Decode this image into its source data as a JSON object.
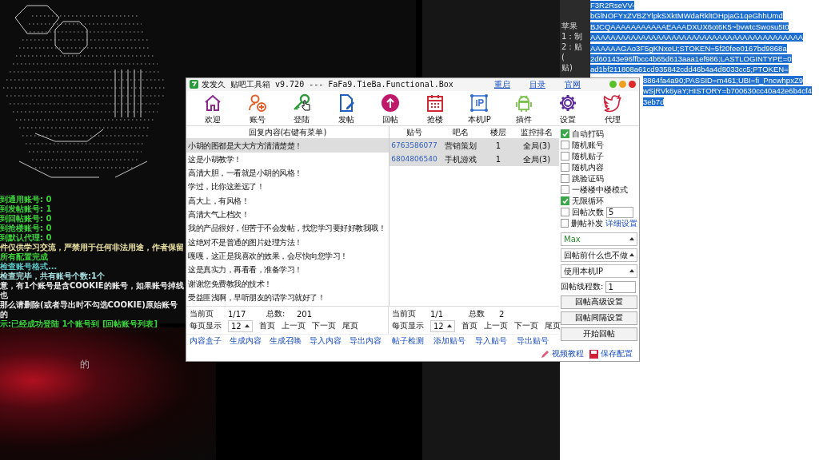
{
  "console": {
    "lines": [
      {
        "text": "到通用账号: 0",
        "color": "#3cd23c"
      },
      {
        "text": "到发帖账号: 1",
        "color": "#3cd23c"
      },
      {
        "text": "到回帖账号: 0",
        "color": "#3cd23c"
      },
      {
        "text": "到抢楼账号: 0",
        "color": "#3cd23c"
      },
      {
        "text": "到默认代理: 0",
        "color": "#3cd23c"
      },
      {
        "text": "件仅供学习交流，严禁用于任何非法用途，作者保留",
        "color": "#e8e0a0"
      },
      {
        "text": "所有配置完成",
        "color": "#3cd23c"
      },
      {
        "text": "检查账号格式...",
        "color": "#5ac8c8"
      },
      {
        "text": "检查完毕，共有账号个数:1个",
        "color": "#a8e0e0"
      },
      {
        "text": "意，有1个账号是含COOKIE的账号，如果账号掉线也",
        "color": "#e8e8e8"
      },
      {
        "text": "那么请删除(或者导出时不勾选COOKIE)原始账号的",
        "color": "#e8e8e8"
      },
      {
        "text": "示:已经成功登陆 1个账号到 [回帖账号列表]",
        "color": "#3cd23c"
      }
    ]
  },
  "background_text": "的",
  "editor": {
    "gutter_lines": [
      "苹果",
      "1：制",
      "2：贴",
      "(",
      "贴)"
    ],
    "selected_lines": [
      "F3R2RseVV-",
      "bGlNOFYxZVBZYlpkSXktMWdaRkltOHpjaG1qeGhhUmd",
      "BJCQAAAAAAAAAAAEAAADXUX6ot6K5~bvwtcSwosu5t0",
      "AAAAAAAAAAAAAAAAAAAAAAAAAAAAAAAAAAAAAAAAAA",
      "AAAAAAGAo3F5gKNxeU;STOKEN=5f20fee0167bd9868a",
      "2d60143e96ffbcc4b65d613aaa1ef986;LASTLOGINTYPE=0",
      "ad1bf211808a61cd935842cdd46b4a4d8033cc5;PTOKEN=",
      "8864fa4a90;PASSID=m461;UBI=fi_PncwhpxZ9",
      "wSjRVk6yaY;HISTORY=b700630cc40a42e6b4cf4",
      "3eb7d"
    ]
  },
  "app": {
    "title": "发发久  贴吧工具箱 v9.720 --- FaFa9.TieBa.Functional.Box",
    "header_links": [
      "重启",
      "目录",
      "官网"
    ],
    "toolbar": [
      {
        "label": "欢迎"
      },
      {
        "label": "账号"
      },
      {
        "label": "登陆"
      },
      {
        "label": "发帖"
      },
      {
        "label": "回帖"
      },
      {
        "label": "抢楼"
      },
      {
        "label": "本机IP"
      },
      {
        "label": "插件"
      },
      {
        "label": "设置"
      },
      {
        "label": "代理"
      }
    ],
    "reply_table": {
      "header": "回复内容(右键有菜单)",
      "rows": [
        {
          "text": "小胡的图都是大大方方清清楚楚！",
          "selected": true
        },
        {
          "text": "这是小胡教学！",
          "selected": false
        },
        {
          "text": "高清大胆，一看就是小胡的风格！",
          "selected": false
        },
        {
          "text": "学过，比你这差远了！",
          "selected": false
        },
        {
          "text": "高大上，有风格！",
          "selected": false
        },
        {
          "text": "高清大气上档次！",
          "selected": false
        },
        {
          "text": "我的产品很好，但苦于不会发帖，找您学习要好好教我哦！",
          "selected": false
        },
        {
          "text": "这绝对不是普通的图片处理方法！",
          "selected": false
        },
        {
          "text": "嘎嘎，这正是我喜欢的效果，会尽快向您学习！",
          "selected": false
        },
        {
          "text": "这是真实力，再看看，准备学习！",
          "selected": false
        },
        {
          "text": "谢谢您免费教我的技术！",
          "selected": false
        },
        {
          "text": "受益匪浅啊，早听朋友的话学习就好了！",
          "selected": false
        }
      ]
    },
    "post_table": {
      "columns": [
        "贴号",
        "吧名",
        "楼层",
        "监控排名"
      ],
      "rows": [
        {
          "post_id": "6763586077",
          "bar": "营销策划",
          "floor": "1",
          "rank": "全局(3)",
          "selected": true
        },
        {
          "post_id": "6804806540",
          "bar": "手机游戏",
          "floor": "1",
          "rank": "全局(3)",
          "selected": true
        }
      ]
    },
    "options": [
      {
        "kind": "check",
        "label": "自动打码",
        "checked": true
      },
      {
        "kind": "check",
        "label": "随机账号",
        "checked": false
      },
      {
        "kind": "check",
        "label": "随机贴子",
        "checked": false
      },
      {
        "kind": "check",
        "label": "随机内容",
        "checked": false
      },
      {
        "kind": "check",
        "label": "跳验证码",
        "checked": false
      },
      {
        "kind": "check",
        "label": "一楼楼中楼模式",
        "checked": false
      },
      {
        "kind": "check",
        "label": "无限循环",
        "checked": true
      },
      {
        "kind": "count",
        "label": "回帖次数",
        "checked": false,
        "value": "5"
      },
      {
        "kind": "link",
        "label": "删帖补发",
        "checked": false,
        "link": "详细设置"
      }
    ],
    "dropdowns": [
      "Max",
      "回帖前什么也不做",
      "使用本机IP"
    ],
    "threads": {
      "label": "回帖线程数:",
      "value": "1"
    },
    "buttons": [
      "回帖高级设置",
      "回帖间隔设置",
      "开始回帖"
    ],
    "left_pager": {
      "current_label": "当前页",
      "current": "1/17",
      "total_label": "总数:",
      "total": "201",
      "per_page_label": "每页显示",
      "per_page": "12",
      "nav": [
        "首页",
        "上一页",
        "下一页",
        "尾页"
      ]
    },
    "right_pager": {
      "current_label": "当前页",
      "current": "1/1",
      "total_label": "总数",
      "total": "2",
      "per_page_label": "每页显示",
      "per_page": "12",
      "nav": [
        "首页",
        "上一页",
        "下一页",
        "尾页"
      ]
    },
    "left_links": [
      "内容盒子",
      "生成内容",
      "生成召唤",
      "导入内容",
      "导出内容"
    ],
    "right_links": [
      "帖子检测",
      "添加贴号",
      "导入贴号",
      "导出贴号"
    ],
    "footer_links": [
      "视频教程",
      "保存配置"
    ]
  }
}
